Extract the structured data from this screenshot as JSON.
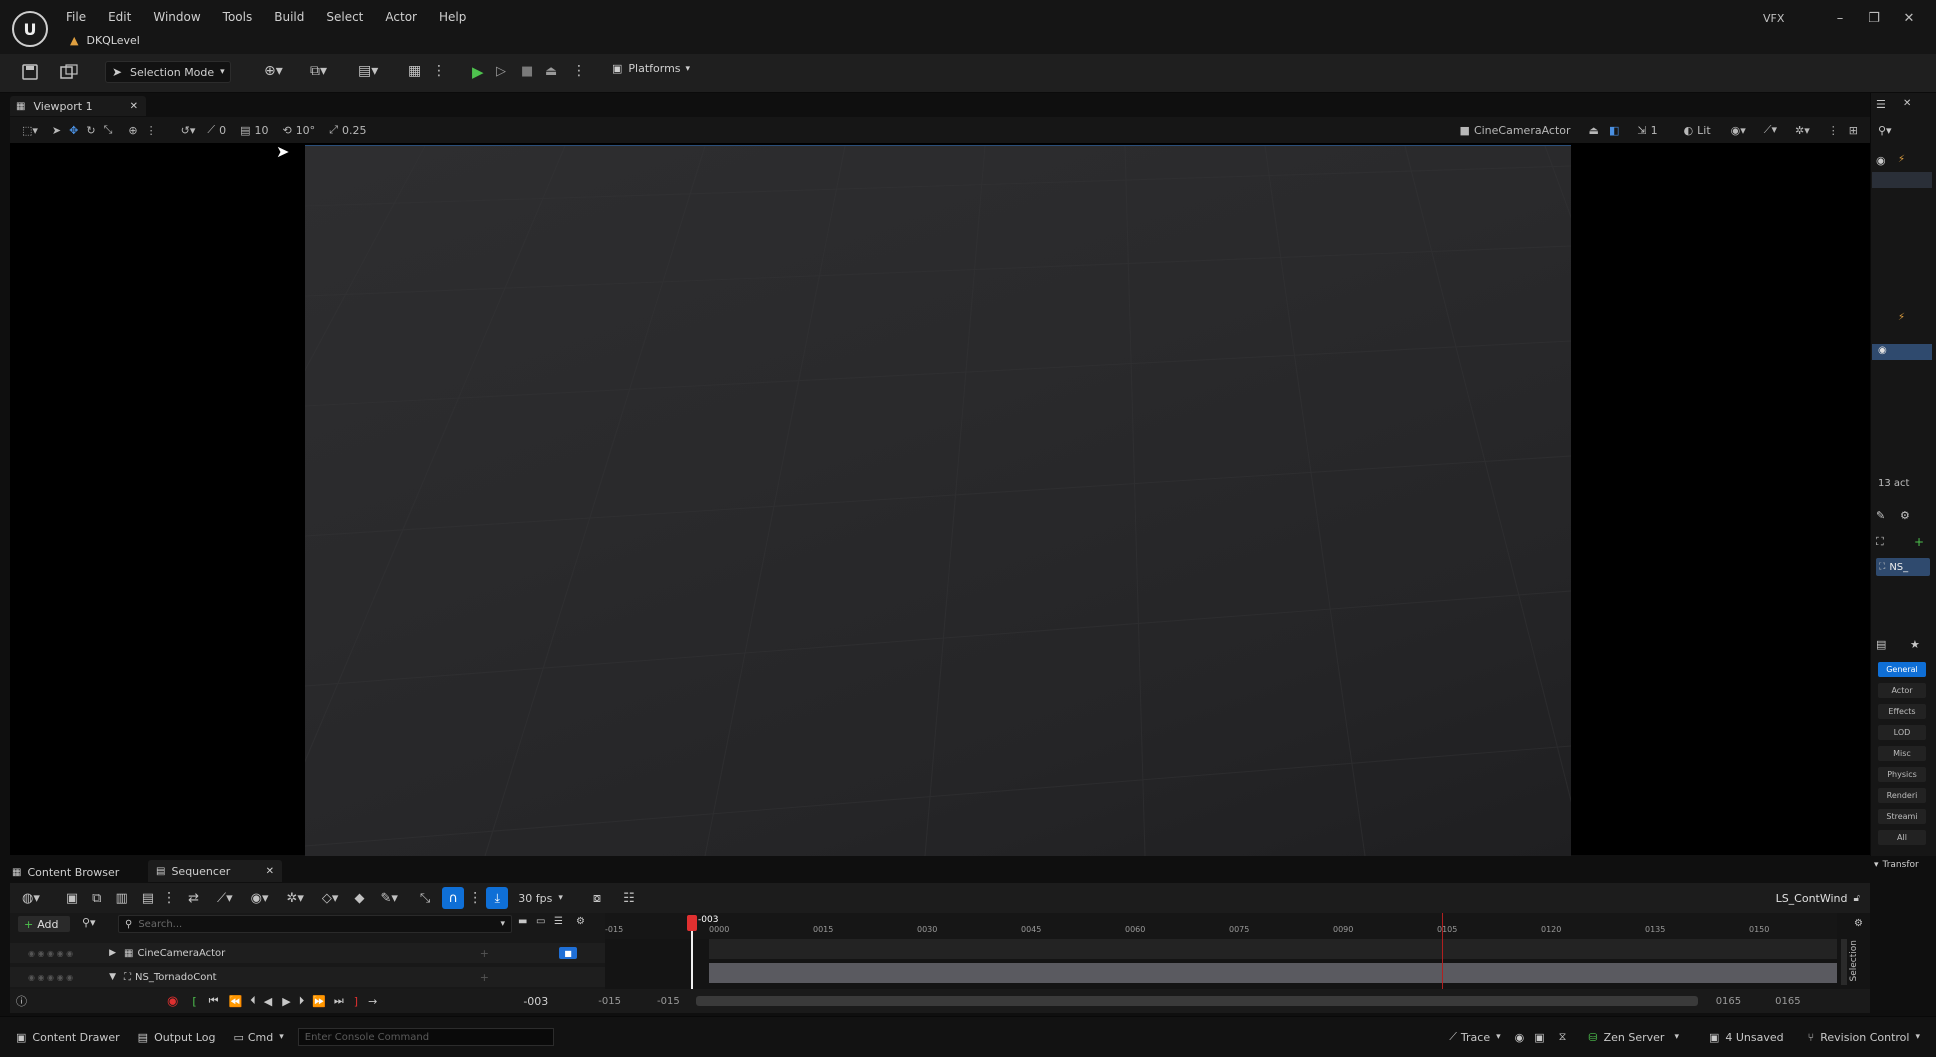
{
  "window": {
    "level_name": "DKQLevel",
    "project_label": "VFX",
    "menu": [
      "File",
      "Edit",
      "Window",
      "Tools",
      "Build",
      "Select",
      "Actor",
      "Help"
    ]
  },
  "toolbar": {
    "selection_mode": "Selection Mode",
    "platforms": "Platforms"
  },
  "viewport": {
    "tab_label": "Viewport 1",
    "rotation_snap": "0",
    "grid_snap": "10",
    "angle_snap": "10°",
    "scale_snap": "0.25",
    "camera": "CineCameraActor",
    "speed": "1",
    "view_mode": "Lit"
  },
  "outliner": {
    "actor_count": "13 act",
    "selected_item": "NS_"
  },
  "details": {
    "filters": [
      "General",
      "Actor",
      "Effects",
      "LOD",
      "Misc",
      "Physics",
      "Renderi",
      "Streami",
      "All"
    ],
    "active_filter": "General",
    "section": "Transfor"
  },
  "bottom_tabs": {
    "content_browser": "Content Browser",
    "sequencer": "Sequencer"
  },
  "sequencer": {
    "add_label": "Add",
    "search_placeholder": "Search...",
    "fps": "30 fps",
    "sequence_name": "LS_ContWind",
    "tracks": [
      "CineCameraActor",
      "NS_TornadoCont"
    ],
    "playhead": "-003",
    "ruler_ticks": [
      "-015",
      "0000",
      "0015",
      "0030",
      "0045",
      "0060",
      "0075",
      "0090",
      "0105",
      "0120",
      "0135",
      "0150"
    ],
    "current_frame": "-003",
    "view_start": "-015",
    "play_start": "-015",
    "play_end": "0165",
    "view_end": "0165"
  },
  "statusbar": {
    "content_drawer": "Content Drawer",
    "output_log": "Output Log",
    "cmd": "Cmd",
    "console_placeholder": "Enter Console Command",
    "trace": "Trace",
    "zen_server": "Zen Server",
    "unsaved": "4 Unsaved",
    "revision_control": "Revision Control"
  }
}
